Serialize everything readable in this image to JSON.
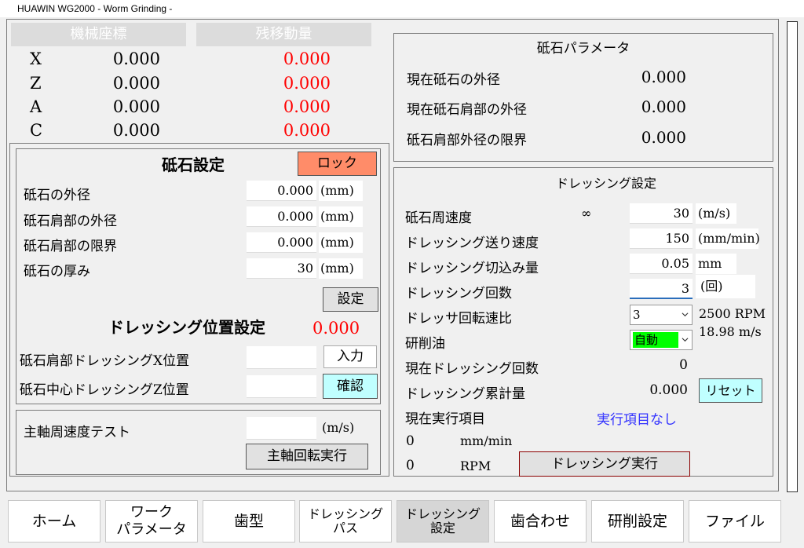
{
  "window": {
    "title": "HUAWIN WG2000 - Worm Grinding -"
  },
  "coords": {
    "machine_header": "機械座標",
    "remaining_header": "残移動量",
    "rows": [
      {
        "axis": "X",
        "machine": "0.000",
        "remaining": "0.000"
      },
      {
        "axis": "Z",
        "machine": "0.000",
        "remaining": "0.000"
      },
      {
        "axis": "A",
        "machine": "0.000",
        "remaining": "0.000"
      },
      {
        "axis": "C",
        "machine": "0.000",
        "remaining": "0.000"
      }
    ]
  },
  "wheel_settings": {
    "title": "砥石設定",
    "lock_label": "ロック",
    "fields": [
      {
        "label": "砥石の外径",
        "value": "0.000",
        "unit": "(mm)"
      },
      {
        "label": "砥石肩部の外径",
        "value": "0.000",
        "unit": "(mm)"
      },
      {
        "label": "砥石肩部の限界",
        "value": "0.000",
        "unit": "(mm)"
      },
      {
        "label": "砥石の厚み",
        "value": "30",
        "unit": "(mm)"
      }
    ],
    "set_label": "設定"
  },
  "dress_position": {
    "title": "ドレッシング位置設定",
    "value": "0.000",
    "x_label": "砥石肩部ドレッシングX位置",
    "x_value": "",
    "input_label": "入力",
    "z_label": "砥石中心ドレッシングZ位置",
    "z_value": "",
    "confirm_label": "確認"
  },
  "spindle_test": {
    "label": "主軸周速度テスト",
    "value": "",
    "unit": "(m/s)",
    "run_label": "主軸回転実行"
  },
  "wheel_params": {
    "title": "砥石パラメータ",
    "rows": [
      {
        "label": "現在砥石の外径",
        "value": "0.000"
      },
      {
        "label": "現在砥石肩部の外径",
        "value": "0.000"
      },
      {
        "label": "砥石肩部外径の限界",
        "value": "0.000"
      }
    ]
  },
  "dressing_settings": {
    "title": "ドレッシング設定",
    "wheel_speed_label": "砥石周速度",
    "infinity": "∞",
    "wheel_speed_value": "30",
    "wheel_speed_unit": "(m/s)",
    "feed_label": "ドレッシング送り速度",
    "feed_value": "150",
    "feed_unit": "(mm/min)",
    "cut_label": "ドレッシング切込み量",
    "cut_value": "0.05",
    "cut_unit": "mm",
    "count_label": "ドレッシング回数",
    "count_value": "3",
    "count_unit": "(回)",
    "ratio_label": "ドレッサ回転速比",
    "ratio_value": "3",
    "rpm_text": "2500 RPM",
    "ms_text": "18.98 m/s",
    "oil_label": "研削油",
    "oil_value": "自動",
    "oil_color": "#00ff00",
    "current_count_label": "現在ドレッシング回数",
    "current_count_value": "0",
    "cumulative_label": "ドレッシング累計量",
    "cumulative_value": "0.000",
    "reset_label": "リセット",
    "current_item_label": "現在実行項目",
    "current_item_value": "実行項目なし",
    "speed_value": "0",
    "speed_unit": "mm/min",
    "rpm_value": "0",
    "rpm_unit": "RPM",
    "run_label": "ドレッシング実行"
  },
  "nav": {
    "items": [
      {
        "label": "ホーム"
      },
      {
        "line1": "ワーク",
        "line2": "パラメータ"
      },
      {
        "label": "歯型"
      },
      {
        "line1": "ドレッシング",
        "line2": "パス"
      },
      {
        "line1": "ドレッシング",
        "line2": "設定"
      },
      {
        "label": "歯合わせ"
      },
      {
        "label": "研削設定"
      },
      {
        "label": "ファイル"
      }
    ]
  },
  "colors": {
    "lock_bg": "#ff8c69",
    "cyan_btn": "#c0ffff",
    "value_red": "#ff0000",
    "link_blue": "#3232ff"
  }
}
